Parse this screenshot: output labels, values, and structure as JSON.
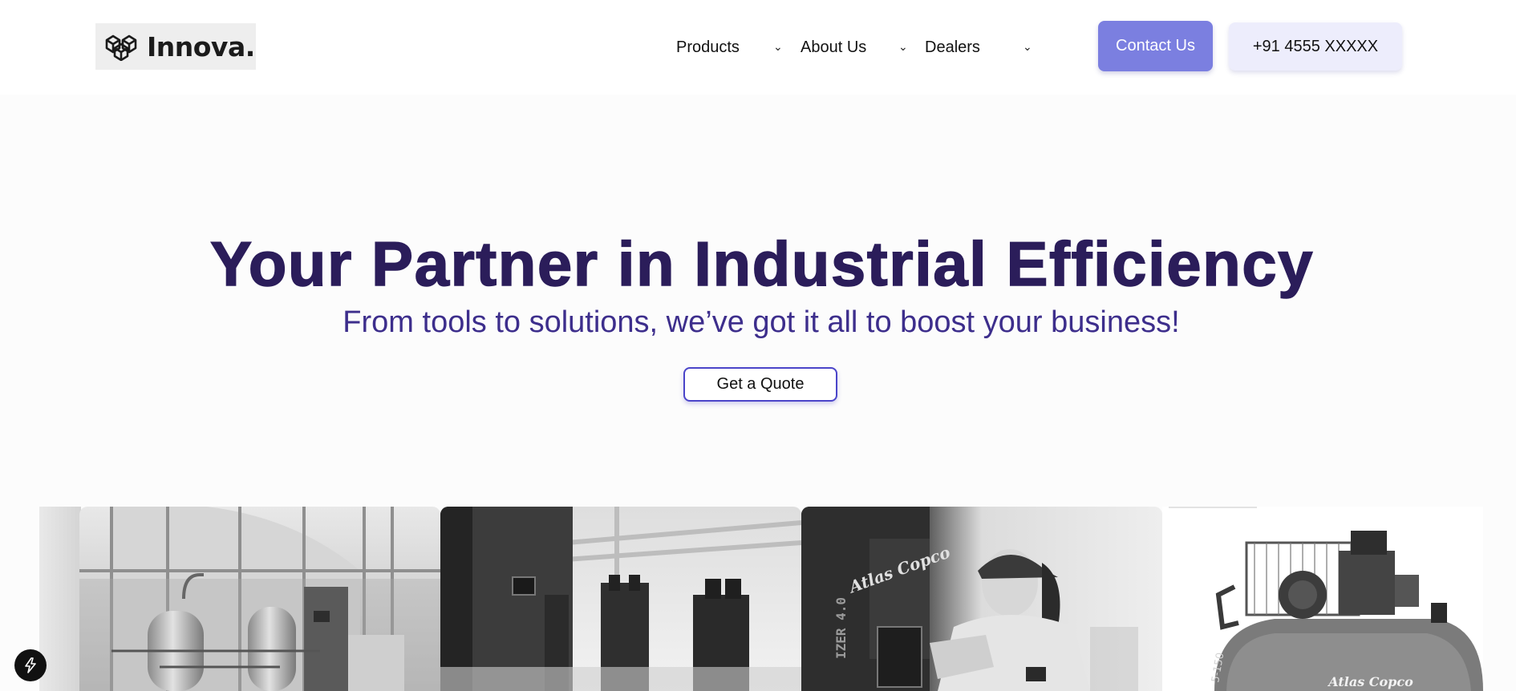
{
  "brand": {
    "name": "Innova."
  },
  "nav": {
    "items": [
      {
        "label": "Products"
      },
      {
        "label": "About Us"
      },
      {
        "label": "Dealers"
      }
    ]
  },
  "actions": {
    "contact_label": "Contact Us",
    "phone_label": "+91 4555 XXXXX"
  },
  "hero": {
    "title": "Your Partner in Industrial Efficiency",
    "subtitle": "From tools to solutions, we’ve got it all to boost your business!",
    "cta_label": "Get a Quote"
  },
  "gallery": {
    "images": [
      {
        "name": "air-treatment-tanks-image"
      },
      {
        "name": "compressor-room-image"
      },
      {
        "name": "technician-operating-compressor-image",
        "brand_text": "Atlas Copco",
        "panel_text": "IZER 4.0"
      },
      {
        "name": "piston-compressor-image",
        "brand_text": "Atlas Copco",
        "model_text": "5-150"
      }
    ]
  },
  "colors": {
    "accent": "#7b7fe0",
    "accent_light": "#ededfc",
    "title": "#2b1d5a",
    "subtitle": "#3d2e8c",
    "cta_border": "#4b45c9"
  },
  "icons": {
    "logo": "cubes-icon",
    "dropdown": "chevron-down-icon",
    "floating": "lightning-icon"
  }
}
